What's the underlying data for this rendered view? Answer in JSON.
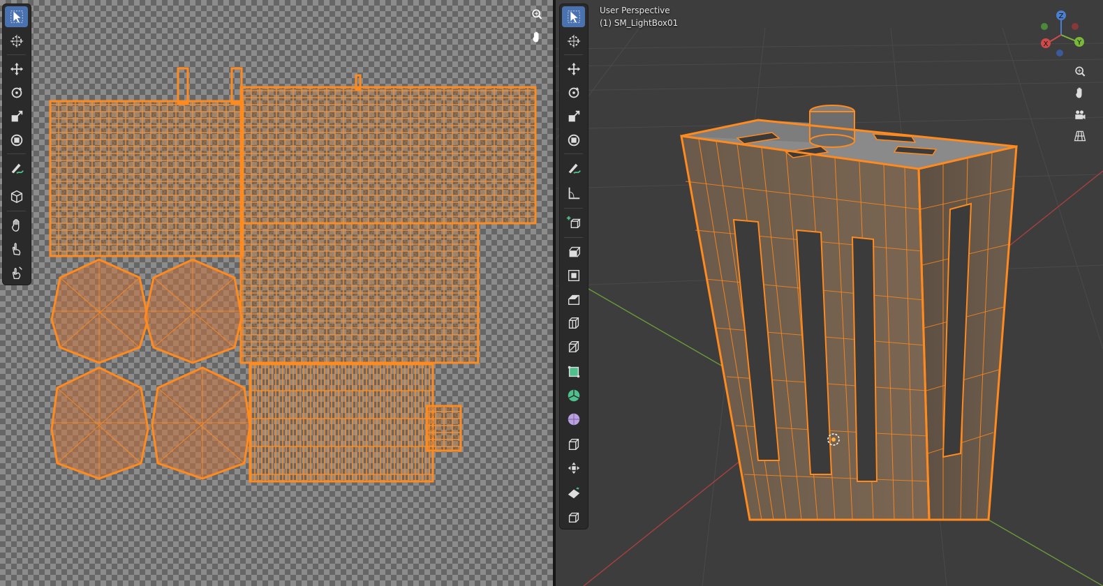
{
  "viewport": {
    "view_name": "User Perspective",
    "object_label": "(1) SM_LightBox01"
  },
  "gizmo": {
    "z_label": "Z",
    "y_label": "Y",
    "x_label": "X"
  },
  "colors": {
    "wire": "#ff8a1e",
    "select_active": "#4a72b0",
    "toolbar_bg": "#2a2a2a",
    "viewport_bg": "#3d3d3d"
  },
  "uv_toolbar_icons": [
    "select-box-icon",
    "cursor-icon",
    "move-icon",
    "rotate-icon",
    "scale-icon",
    "transform-icon",
    "annotate-icon",
    "rip-region-icon",
    "grab-icon",
    "relax-icon",
    "pinch-icon"
  ],
  "viewport_toolbar_icons": [
    "select-box-icon",
    "cursor-icon",
    "move-icon",
    "rotate-icon",
    "scale-icon",
    "transform-icon",
    "annotate-icon",
    "measure-icon",
    "add-cube-icon",
    "extrude-region-icon",
    "inset-faces-icon",
    "bevel-icon",
    "loop-cut-icon",
    "knife-icon",
    "poly-build-icon",
    "spin-icon",
    "smooth-icon",
    "edge-slide-icon",
    "shrink-fatten-icon",
    "shear-icon",
    "rip-icon"
  ]
}
